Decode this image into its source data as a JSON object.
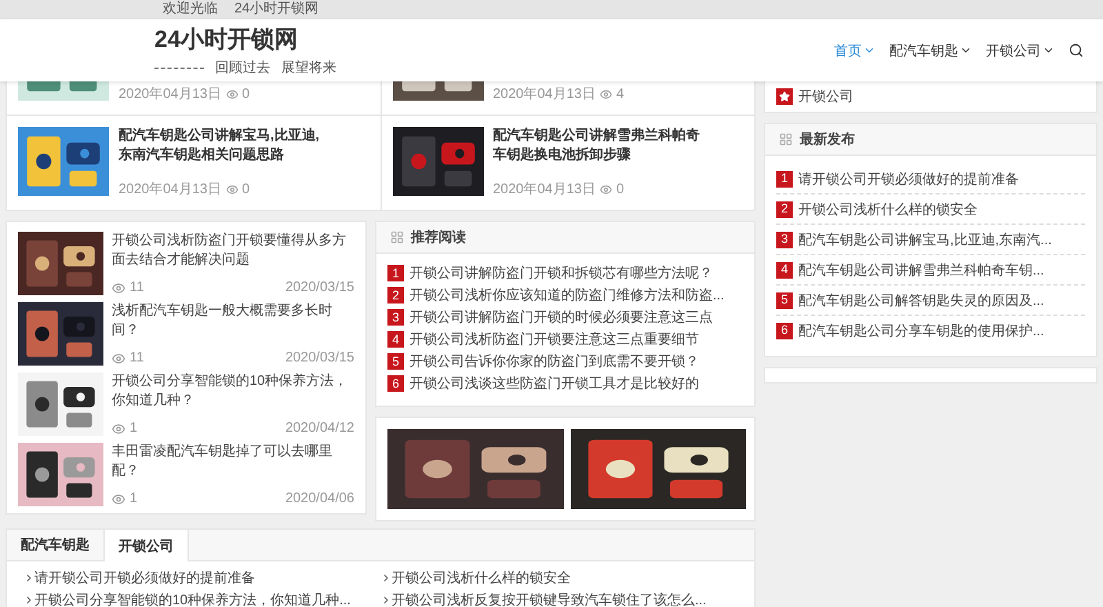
{
  "top_bar": {
    "welcome": "欢迎光临",
    "site_name": "24小时开锁网"
  },
  "header": {
    "logo": "24小时开锁网",
    "slogans": [
      "回顾过去",
      "展望将来"
    ],
    "nav": [
      {
        "label": "首页",
        "selected": true
      },
      {
        "label": "配汽车钥匙",
        "selected": false
      },
      {
        "label": "开锁公司",
        "selected": false
      }
    ]
  },
  "featured_posts": [
    {
      "date": "2020年04月13日",
      "views": "0"
    },
    {
      "date": "2020年04月13日",
      "views": "4"
    },
    {
      "title": "配汽车钥匙公司讲解宝马,比亚迪,东南汽车钥匙相关问题思路",
      "date": "2020年04月13日",
      "views": "0"
    },
    {
      "title": "配汽车钥匙公司讲解雪弗兰科帕奇车钥匙换电池拆卸步骤",
      "date": "2020年04月13日",
      "views": "0"
    }
  ],
  "post_list": [
    {
      "title": "开锁公司浅析防盗门开锁要懂得从多方面去结合才能解决问题",
      "views": "11",
      "date": "2020/03/15"
    },
    {
      "title": "浅析配汽车钥匙一般大概需要多长时间？",
      "views": "11",
      "date": "2020/03/15"
    },
    {
      "title": "开锁公司分享智能锁的10种保养方法，你知道几种？",
      "views": "1",
      "date": "2020/04/12"
    },
    {
      "title": "丰田雷凌配汽车钥匙掉了可以去哪里配？",
      "views": "1",
      "date": "2020/04/06"
    }
  ],
  "recommended": {
    "title": "推荐阅读",
    "items": [
      {
        "rank": "1",
        "title": "开锁公司讲解防盗门开锁和拆锁芯有哪些方法呢？"
      },
      {
        "rank": "2",
        "title": "开锁公司浅析你应该知道的防盗门维修方法和防盗..."
      },
      {
        "rank": "3",
        "title": "开锁公司讲解防盗门开锁的时候必须要注意这三点"
      },
      {
        "rank": "4",
        "title": "开锁公司浅析防盗门开锁要注意这三点重要细节"
      },
      {
        "rank": "5",
        "title": "开锁公司告诉你你家的防盗门到底需不要开锁？"
      },
      {
        "rank": "6",
        "title": "开锁公司浅谈这些防盗门开锁工具才是比较好的"
      }
    ]
  },
  "sidebar": {
    "categories": {
      "items": [
        "开锁公司"
      ]
    },
    "latest": {
      "title": "最新发布",
      "items": [
        {
          "rank": "1",
          "title": "请开锁公司开锁必须做好的提前准备"
        },
        {
          "rank": "2",
          "title": "开锁公司浅析什么样的锁安全"
        },
        {
          "rank": "3",
          "title": "配汽车钥匙公司讲解宝马,比亚迪,东南汽..."
        },
        {
          "rank": "4",
          "title": "配汽车钥匙公司讲解雪弗兰科帕奇车钥..."
        },
        {
          "rank": "5",
          "title": "配汽车钥匙公司解答钥匙失灵的原因及..."
        },
        {
          "rank": "6",
          "title": "配汽车钥匙公司分享车钥匙的使用保护..."
        }
      ]
    }
  },
  "tab_panel": {
    "tabs": [
      {
        "label": "配汽车钥匙",
        "selected": false
      },
      {
        "label": "开锁公司",
        "selected": true
      }
    ],
    "links": [
      "请开锁公司开锁必须做好的提前准备",
      "开锁公司浅析什么样的锁安全",
      "开锁公司分享智能锁的10种保养方法，你知道几种...",
      "开锁公司浅析反复按开锁键导致汽车锁住了该怎么..."
    ]
  }
}
